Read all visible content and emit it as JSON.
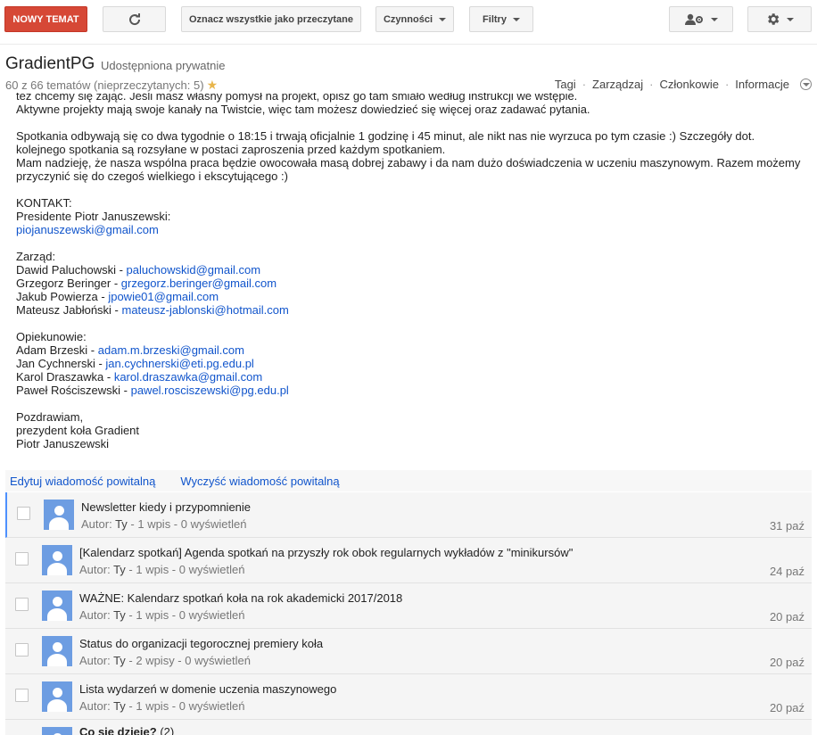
{
  "toolbar": {
    "new_topic": "NOWY TEMAT",
    "mark_all_read": "Oznacz wszystkie jako przeczytane",
    "actions": "Czynności",
    "filters": "Filtry",
    "refresh_icon": "refresh-icon",
    "members_icon": "person-gear-icon",
    "settings_icon": "gear-icon"
  },
  "header": {
    "group_name": "GradientPG",
    "sharing": "Udostępniona prywatnie",
    "topic_count": "60 z 66 tematów (nieprzeczytanych: 5)",
    "links": [
      "Tagi",
      "Zarządzaj",
      "Członkowie",
      "Informacje"
    ]
  },
  "welcome": {
    "lines": [
      "też chcemy się zająć. Jeśli masz własny pomysł na projekt, opisz go tam śmiało według instrukcji we wstępie.",
      "Aktywne projekty mają swoje kanały na Twistcie, więc tam możesz dowiedzieć się więcej oraz zadawać pytania.",
      "",
      "Spotkania odbywają się co dwa tygodnie o 18:15 i trwają oficjalnie 1 godzinę i 45 minut, ale nikt nas nie wyrzuca po tym czasie :) Szczegóły dot.",
      "kolejnego spotkania są rozsyłane w postaci zaproszenia przed każdym spotkaniem.",
      "Mam nadzieję, że nasza wspólna praca będzie owocowała masą dobrej zabawy i da nam dużo doświadczenia w uczeniu maszynowym. Razem możemy",
      "przyczynić się do czegoś wielkiego i ekscytującego :)",
      "",
      "KONTAKT:",
      "Presidente Piotr Januszewski:"
    ],
    "president_email": "piojanuszewski@gmail.com",
    "board_label": "Zarząd:",
    "board": [
      {
        "name": "Dawid Paluchowski - ",
        "email": "paluchowskid@gmail.com"
      },
      {
        "name": "Grzegorz Beringer - ",
        "email": "grzegorz.beringer@gmail.com"
      },
      {
        "name": "Jakub Powierza - ",
        "email": "jpowie01@gmail.com"
      },
      {
        "name": "Mateusz Jabłoński - ",
        "email": "mateusz-jablonski@hotmail.com"
      }
    ],
    "mentors_label": "Opiekunowie:",
    "mentors": [
      {
        "name": "Adam Brzeski - ",
        "email": "adam.m.brzeski@gmail.com"
      },
      {
        "name": "Jan Cychnerski - ",
        "email": "jan.cychnerski@eti.pg.edu.pl"
      },
      {
        "name": "Karol Draszawka - ",
        "email": "karol.draszawka@gmail.com"
      },
      {
        "name": "Paweł Rościszewski - ",
        "email": "pawel.rosciszewski@pg.edu.pl"
      }
    ],
    "closing": [
      "Pozdrawiam,",
      "prezydent koła Gradient",
      "Piotr Januszewski"
    ]
  },
  "welcome_actions": {
    "edit": "Edytuj wiadomość powitalną",
    "clear": "Wyczyść wiadomość powitalną"
  },
  "topics": [
    {
      "title": "Newsletter kiedy i przypomnienie",
      "author_label": "Autor: ",
      "author": "Ty",
      "stats": " - 1 wpis - 0 wyświetleń",
      "date": "31 paź"
    },
    {
      "title": "[Kalendarz spotkań] Agenda spotkań na przyszły rok obok regularnych wykładów z \"minikursów\"",
      "author_label": "Autor: ",
      "author": "Ty",
      "stats": " - 1 wpis - 0 wyświetleń",
      "date": "24 paź"
    },
    {
      "title": "WAŻNE: Kalendarz spotkań koła na rok akademicki 2017/2018",
      "author_label": "Autor: ",
      "author": "Ty",
      "stats": " - 1 wpis - 0 wyświetleń",
      "date": "20 paź"
    },
    {
      "title": "Status do organizacji tegorocznej premiery koła",
      "author_label": "Autor: ",
      "author": "Ty",
      "stats": " - 2 wpisy - 0 wyświetleń",
      "date": "20 paź"
    },
    {
      "title": "Lista wydarzeń w domenie uczenia maszynowego",
      "author_label": "Autor: ",
      "author": "Ty",
      "stats": " - 1 wpis - 0 wyświetleń",
      "date": "20 paź"
    },
    {
      "title": "Co się dzieje?",
      "count": "(2)"
    }
  ]
}
